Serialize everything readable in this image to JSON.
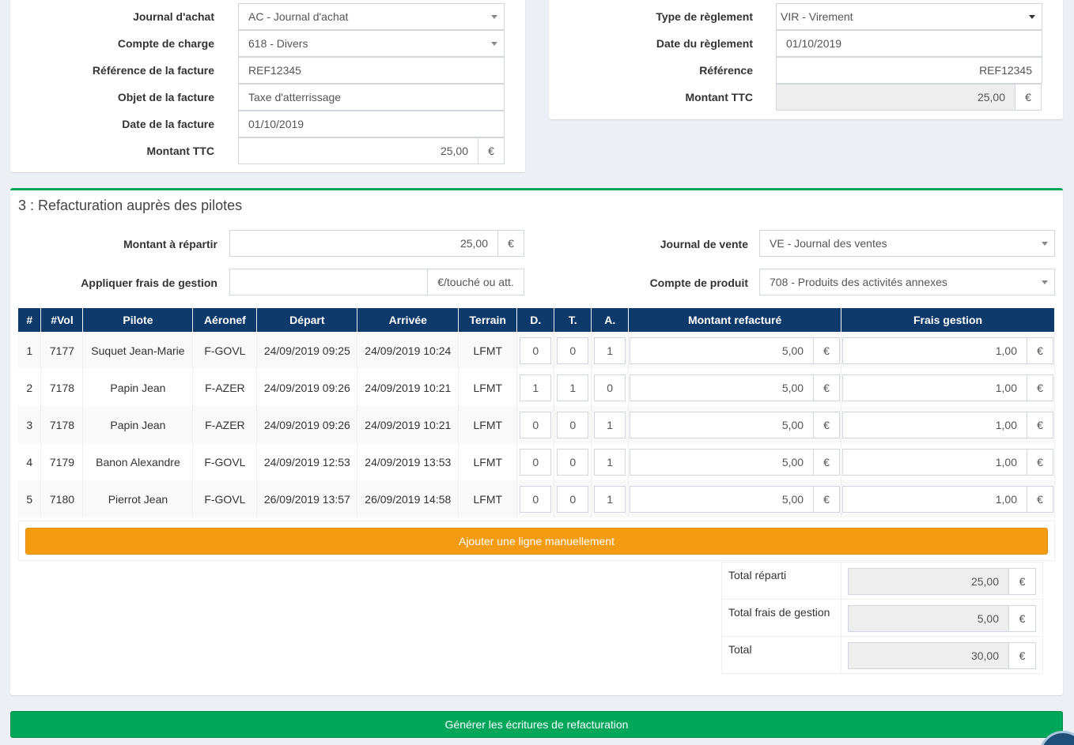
{
  "purchase": {
    "journal_label": "Journal d'achat",
    "journal_value": "AC - Journal d'achat",
    "account_label": "Compte de charge",
    "account_value": "618 - Divers",
    "ref_label": "Référence de la facture",
    "ref_value": "REF12345",
    "object_label": "Objet de la facture",
    "object_value": "Taxe d'atterrissage",
    "date_label": "Date de la facture",
    "date_value": "01/10/2019",
    "amount_label": "Montant TTC",
    "amount_value": "25,00",
    "currency": "€"
  },
  "payment": {
    "type_label": "Type de règlement",
    "type_value": "VIR - Virement",
    "date_label": "Date du règlement",
    "date_value": "01/10/2019",
    "ref_label": "Référence",
    "ref_value": "REF12345",
    "amount_label": "Montant TTC",
    "amount_value": "25,00",
    "currency": "€"
  },
  "rebilling": {
    "title": "3 : Refacturation auprès des pilotes",
    "amount_label": "Montant à répartir",
    "amount_value": "25,00",
    "currency": "€",
    "fees_label": "Appliquer frais de gestion",
    "fees_value": "",
    "fees_unit": "€/touché ou att.",
    "sales_journal_label": "Journal de vente",
    "sales_journal_value": "VE - Journal des ventes",
    "product_account_label": "Compte de produit",
    "product_account_value": "708 - Produits des activités annexes",
    "columns": [
      "#",
      "#Vol",
      "Pilote",
      "Aéronef",
      "Départ",
      "Arrivée",
      "Terrain",
      "D.",
      "T.",
      "A.",
      "Montant refacturé",
      "Frais gestion"
    ],
    "rows": [
      {
        "n": "1",
        "vol": "7177",
        "pilot": "Suquet Jean-Marie",
        "aircraft": "F-GOVL",
        "dep": "24/09/2019 09:25",
        "arr": "24/09/2019 10:24",
        "field": "LFMT",
        "d": "0",
        "t": "0",
        "a": "1",
        "amount": "5,00",
        "fee": "1,00",
        "cur": "€"
      },
      {
        "n": "2",
        "vol": "7178",
        "pilot": "Papin Jean",
        "aircraft": "F-AZER",
        "dep": "24/09/2019 09:26",
        "arr": "24/09/2019 10:21",
        "field": "LFMT",
        "d": "1",
        "t": "1",
        "a": "0",
        "amount": "5,00",
        "fee": "1,00",
        "cur": "€"
      },
      {
        "n": "3",
        "vol": "7178",
        "pilot": "Papin Jean",
        "aircraft": "F-AZER",
        "dep": "24/09/2019 09:26",
        "arr": "24/09/2019 10:21",
        "field": "LFMT",
        "d": "0",
        "t": "0",
        "a": "1",
        "amount": "5,00",
        "fee": "1,00",
        "cur": "€"
      },
      {
        "n": "4",
        "vol": "7179",
        "pilot": "Banon Alexandre",
        "aircraft": "F-GOVL",
        "dep": "24/09/2019 12:53",
        "arr": "24/09/2019 13:53",
        "field": "LFMT",
        "d": "0",
        "t": "0",
        "a": "1",
        "amount": "5,00",
        "fee": "1,00",
        "cur": "€"
      },
      {
        "n": "5",
        "vol": "7180",
        "pilot": "Pierrot Jean",
        "aircraft": "F-GOVL",
        "dep": "26/09/2019 13:57",
        "arr": "26/09/2019 14:58",
        "field": "LFMT",
        "d": "0",
        "t": "0",
        "a": "1",
        "amount": "5,00",
        "fee": "1,00",
        "cur": "€"
      }
    ],
    "add_line_label": "Ajouter une ligne manuellement",
    "totals": [
      {
        "label": "Total réparti",
        "value": "25,00",
        "cur": "€"
      },
      {
        "label": "Total frais de gestion",
        "value": "5,00",
        "cur": "€"
      },
      {
        "label": "Total",
        "value": "30,00",
        "cur": "€"
      }
    ]
  },
  "generate_label": "Générer les écritures de refacturation",
  "colors": {
    "header_blue": "#0d3a6b",
    "orange": "#f39c12",
    "green": "#00a65a"
  }
}
